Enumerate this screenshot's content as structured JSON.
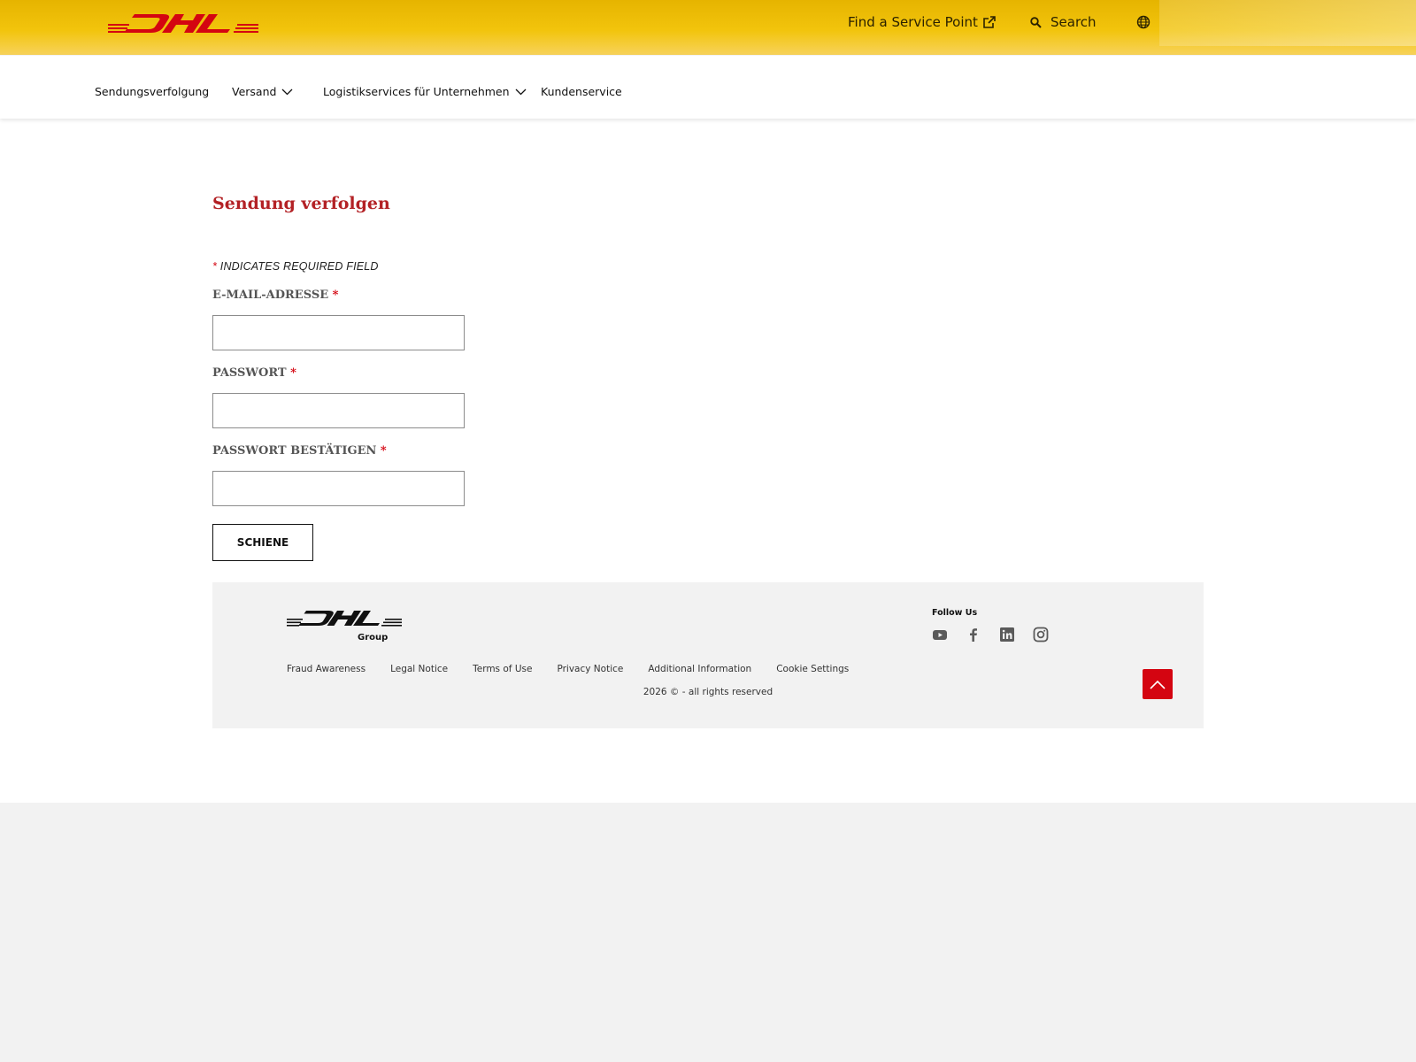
{
  "header": {
    "logo_text": "DHL",
    "find_service_point": "Find a Service Point",
    "search_label": "Search"
  },
  "nav": {
    "items": [
      {
        "label": "Sendungsverfolgung"
      },
      {
        "label": "Versand"
      },
      {
        "label": "Logistikservices für Unternehmen"
      },
      {
        "label": "Kundenservice"
      }
    ]
  },
  "form": {
    "title": "Sendung verfolgen",
    "required_star": "*",
    "required_note": "INDICATES REQUIRED FIELD",
    "email_label": "E-MAIL-ADRESSE",
    "email_value": "",
    "password_label": "PASSWORT",
    "password_value": "",
    "password_confirm_label": "PASSWORT BESTÄTIGEN",
    "password_confirm_value": "",
    "submit_label": "SCHIENE"
  },
  "footer": {
    "logo_text": "DHL",
    "logo_sub": "Group",
    "follow_us": "Follow Us",
    "links": [
      "Fraud Awareness",
      "Legal Notice",
      "Terms of Use",
      "Privacy Notice",
      "Additional Information",
      "Cookie Settings"
    ],
    "copyright": "2026 © - all rights reserved",
    "social_icons": [
      "youtube-icon",
      "facebook-icon",
      "linkedin-icon",
      "instagram-icon"
    ]
  },
  "colors": {
    "brand_yellow": "#ffcc00",
    "brand_red": "#d40511",
    "title_red": "#b32125"
  }
}
